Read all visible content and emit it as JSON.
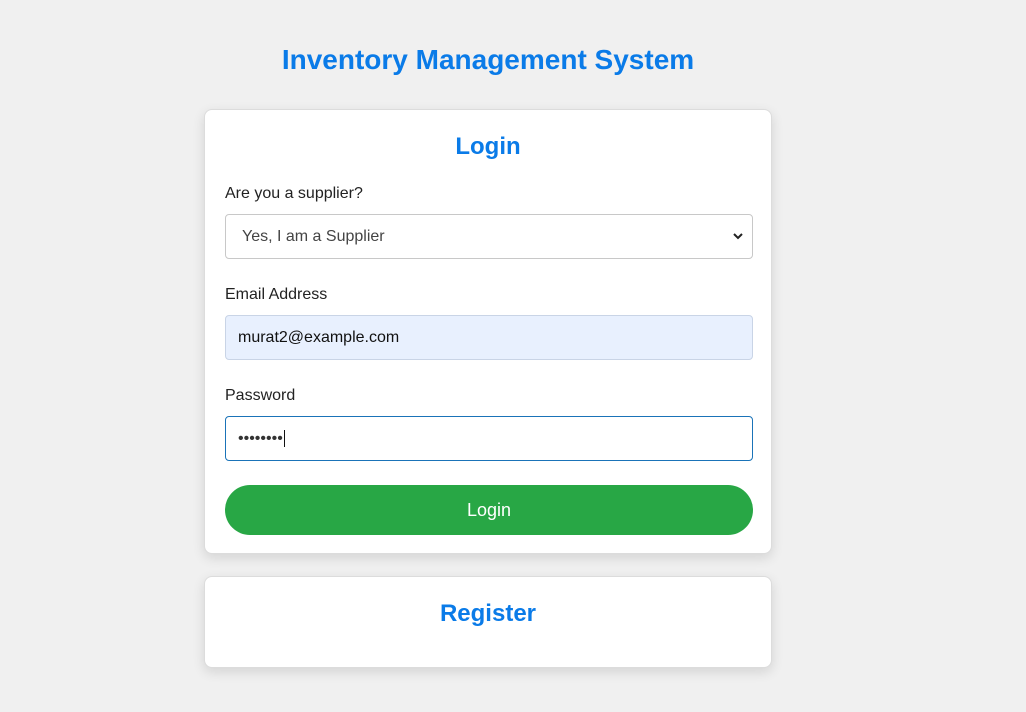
{
  "app_title": "Inventory Management System",
  "login": {
    "title": "Login",
    "supplier_label": "Are you a supplier?",
    "supplier_selected": "Yes, I am a Supplier",
    "email_label": "Email Address",
    "email_value": "murat2@example.com",
    "password_label": "Password",
    "password_value": "••••••••",
    "submit_label": "Login"
  },
  "register": {
    "title": "Register"
  },
  "colors": {
    "accent": "#0a7be8",
    "submit": "#28a745",
    "autofill_bg": "#e8f0fe",
    "background": "#f0f0f0"
  },
  "icons": {
    "select_arrow": "chevron-down-icon"
  }
}
